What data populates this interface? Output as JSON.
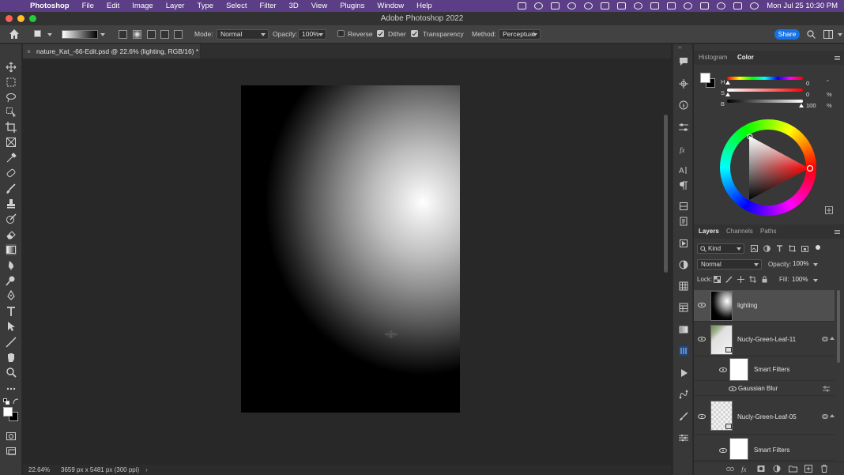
{
  "menubar": {
    "app": "Photoshop",
    "items": [
      "File",
      "Edit",
      "Image",
      "Layer",
      "Type",
      "Select",
      "Filter",
      "3D",
      "View",
      "Plugins",
      "Window",
      "Help"
    ],
    "clock": "Mon Jul 25  10:30 PM",
    "menubar_color": "#5b3e86"
  },
  "window": {
    "title": "Adobe Photoshop 2022"
  },
  "options": {
    "mode_label": "Mode:",
    "mode_value": "Normal",
    "opacity_label": "Opacity:",
    "opacity_value": "100%",
    "reverse_label": "Reverse",
    "reverse_checked": false,
    "dither_label": "Dither",
    "dither_checked": true,
    "transparency_label": "Transparency",
    "transparency_checked": true,
    "method_label": "Method:",
    "method_value": "Perceptual",
    "share_label": "Share",
    "accent": "#1473e6"
  },
  "document": {
    "tab_title": "nature_Kat_-66-Edit.psd @ 22.6% (lighting, RGB/16) *",
    "close": "×"
  },
  "status": {
    "zoom": "22.64%",
    "dimensions": "3659 px x 5481 px (300 ppi)",
    "arrow": "›"
  },
  "color_panel": {
    "tabs": [
      "Histogram",
      "Color"
    ],
    "active_tab": "Color",
    "h_label": "H",
    "h_value": "0",
    "h_unit": "°",
    "s_label": "S",
    "s_value": "0",
    "s_unit": "%",
    "b_label": "B",
    "b_value": "100",
    "b_unit": "%",
    "foreground": "#ffffff",
    "background": "#000000"
  },
  "layers_panel": {
    "tabs": [
      "Layers",
      "Channels",
      "Paths"
    ],
    "active_tab": "Layers",
    "filter_value": "Kind",
    "blend_mode": "Normal",
    "opacity_label": "Opacity:",
    "opacity_value": "100%",
    "lock_label": "Lock:",
    "fill_label": "Fill:",
    "fill_value": "100%",
    "layers": [
      {
        "name": "lighting",
        "selected": true
      },
      {
        "name": "Nucly-Green-Leaf-11",
        "selected": false
      },
      {
        "name": "Smart Filters",
        "selected": false
      },
      {
        "name": "Gaussian Blur",
        "selected": false
      },
      {
        "name": "Nucly-Green-Leaf-05",
        "selected": false
      },
      {
        "name": "Smart Filters",
        "selected": false
      }
    ]
  }
}
